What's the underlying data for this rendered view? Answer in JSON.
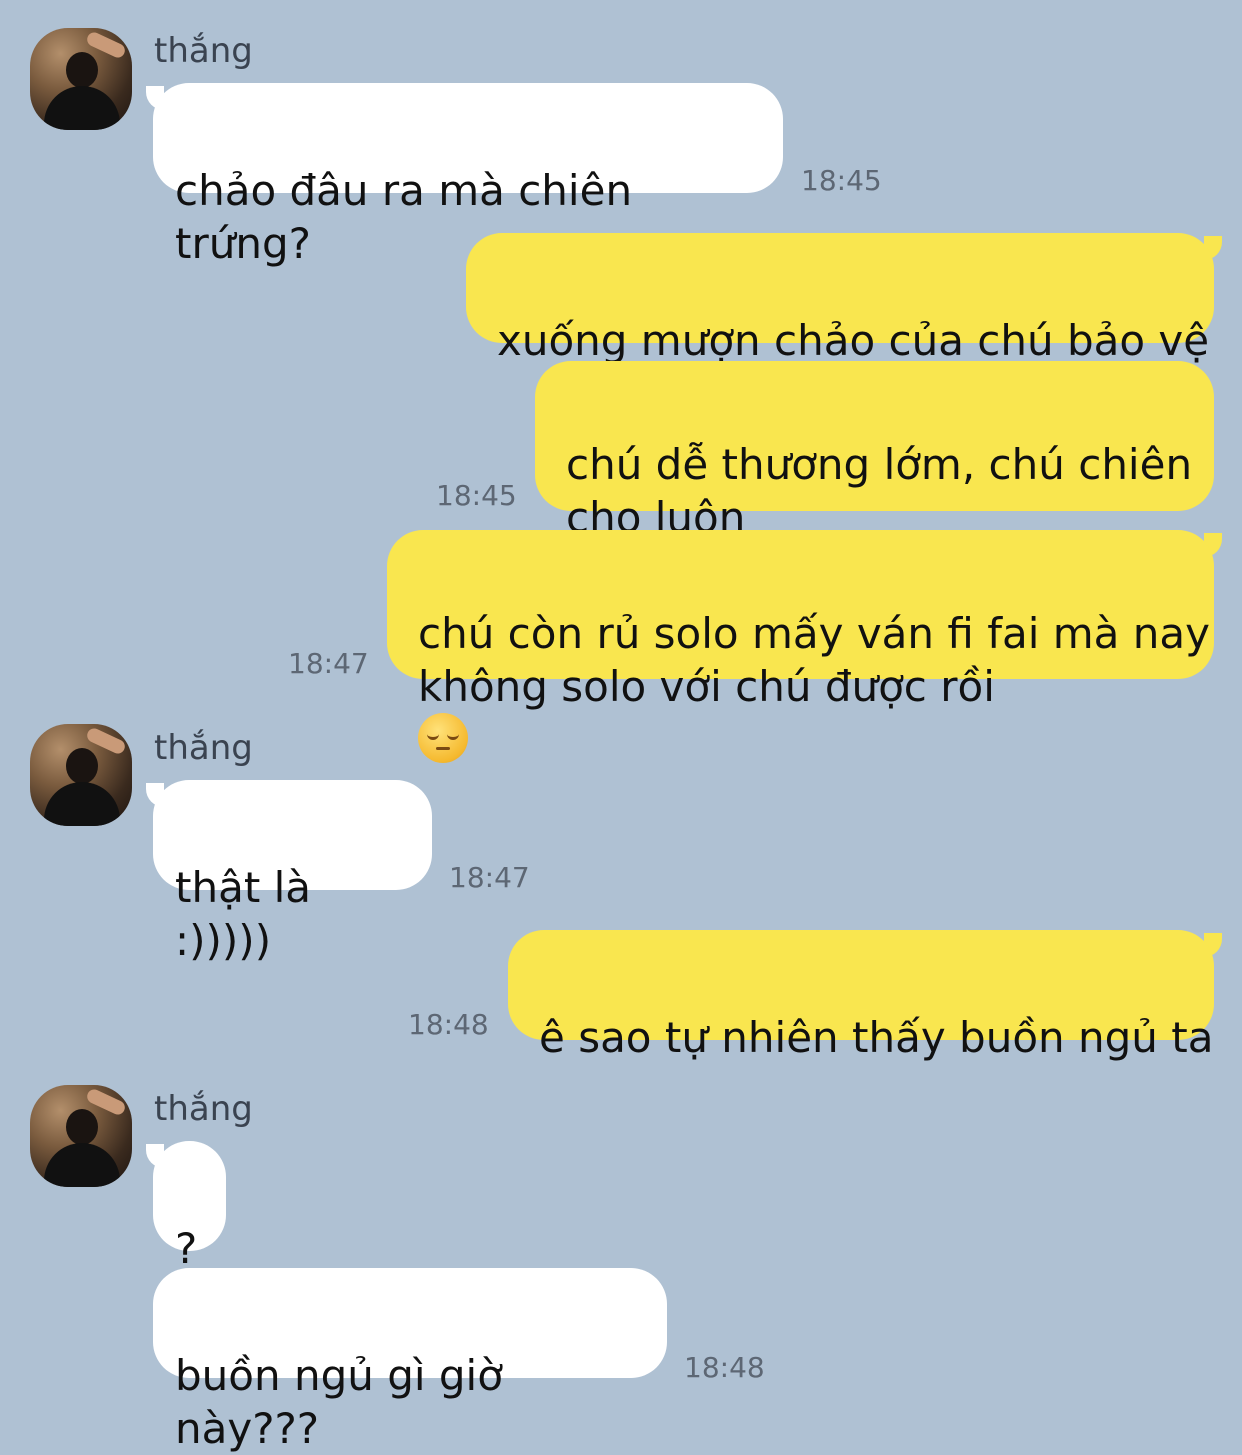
{
  "contact": {
    "name": "thắng"
  },
  "messages": [
    {
      "side": "in",
      "text": "chảo đâu ra mà chiên trứng?",
      "time": "18:45"
    },
    {
      "side": "out",
      "text": "xuống mượn chảo của chú bảo vệ",
      "time": ""
    },
    {
      "side": "out",
      "text": "chú dễ thương lớm, chú chiên\ncho luôn",
      "time": "18:45"
    },
    {
      "side": "out",
      "text": "chú còn rủ solo mấy ván fi fai mà nay\nkhông solo với chú được rồi",
      "emoji": "pensive-face-emoji",
      "time": "18:47"
    },
    {
      "side": "in",
      "text": "thật là :)))))",
      "time": "18:47"
    },
    {
      "side": "out",
      "text": "ê sao tự nhiên thấy buồn ngủ ta",
      "time": "18:48"
    },
    {
      "side": "in",
      "text": "?",
      "time": ""
    },
    {
      "side": "in",
      "text": "buồn ngủ gì giờ này???",
      "time": "18:48"
    }
  ],
  "colors": {
    "background": "#afc1d3",
    "incoming_bubble": "#ffffff",
    "outgoing_bubble": "#f9e64f"
  }
}
